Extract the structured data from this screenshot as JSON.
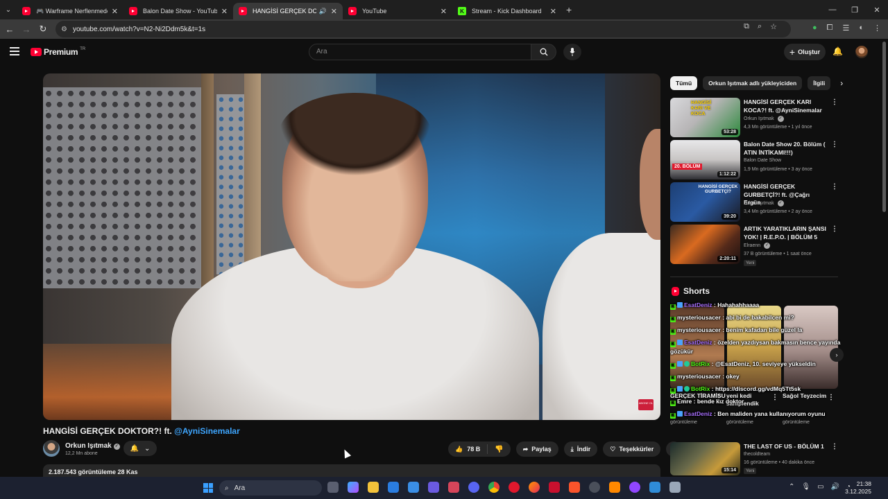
{
  "browser": {
    "tabs": [
      {
        "label": "🎮 Warframe Nerflenmeden O...",
        "active": false
      },
      {
        "label": "Balon Date Show - YouTube",
        "active": false
      },
      {
        "label": "HANGİSİ GERÇEK DOKTOR...",
        "active": true
      },
      {
        "label": "YouTube",
        "active": false
      },
      {
        "label": "Stream - Kick Dashboard",
        "active": false
      }
    ],
    "url": "youtube.com/watch?v=N2-Ni2Ddm5k&t=1s"
  },
  "masthead": {
    "logo_text": "Premium",
    "logo_sup": "TR",
    "search_placeholder": "Ara",
    "create_label": "Oluştur"
  },
  "video": {
    "title_main": "HANGİSİ GERÇEK DOKTOR?! ft. ",
    "title_mention": "@AyniSinemalar",
    "watermark": "ABONE OL",
    "channel": "Orkun Işıtmak",
    "subscribers": "12,2 Mn abone",
    "likes": "78 B",
    "share": "Paylaş",
    "download": "İndir",
    "thanks": "Teşekkürler",
    "description": "2.187.543 görüntüleme  28 Kas"
  },
  "chips": [
    "Tümü",
    "Orkun Işıtmak adlı yükleyiciden",
    "İlgili"
  ],
  "recommendations": [
    {
      "title": "HANGİSİ GERÇEK KARI KOCA?! ft. @AyniSinemalar",
      "channel": "Orkun Işıtmak",
      "verified": true,
      "meta": "4,3 Mn görüntüleme • 1 yıl önce",
      "duration": "53:28",
      "thumb_text": "HANGİSİ KARI VE KOCA"
    },
    {
      "title": "Balon Date Show 20. Bölüm ( ATIN İNTİKAMI!!!)",
      "channel": "Balon Date Show",
      "verified": false,
      "meta": "1,9 Mn görüntüleme • 3 ay önce",
      "duration": "1:12:22",
      "thumb_text": "20. BÖLÜM"
    },
    {
      "title": "HANGİSİ GERÇEK GURBETÇİ?! ft. @Çağrı Ergün",
      "channel": "Orkun Işıtmak",
      "verified": true,
      "meta": "3,4 Mn görüntüleme • 2 ay önce",
      "duration": "39:20",
      "thumb_text": "HANGİSİ GERÇEK GURBETÇİ?"
    },
    {
      "title": "ARTIK YARATIKLARIN ŞANSI YOK! | R.E.P.O. | BÖLÜM 5",
      "channel": "Elraenn",
      "verified": true,
      "meta": "37 B görüntüleme • 1 saat önce",
      "duration": "2:20:11",
      "badge": "Yeni"
    }
  ],
  "shorts": {
    "heading": "Shorts",
    "items": [
      {
        "title": "GERÇEK TİRAMİSU ...",
        "views": "görüntüleme"
      },
      {
        "title": "yeni kedi sahiplendik",
        "views": "görüntüleme"
      },
      {
        "title": "Sağol Teyzecim",
        "views": "görüntüleme"
      }
    ]
  },
  "chat": [
    {
      "user": "EsatDeniz",
      "color": "#a970ff",
      "text": "Hahahahhaaaa"
    },
    {
      "user": "mysteriousacer",
      "color": "#ffffff",
      "text": "abi bi de bakabilcen mi?"
    },
    {
      "user": "mysteriousacer",
      "color": "#ffffff",
      "text": "benim kafadan bile güzel la"
    },
    {
      "user": "EsatDeniz",
      "color": "#a970ff",
      "text": "özelden yazdıysan bakmasın bence yayında gözükür"
    },
    {
      "user": "BotRix",
      "color": "#53fc18",
      "text": "@EsatDeniz, 10. seviyeye yükseldin"
    },
    {
      "user": "mysteriousacer",
      "color": "#ffffff",
      "text": "okey"
    },
    {
      "user": "BotRix",
      "color": "#53fc18",
      "text": "https://discord.gg/vdMq5Tt5sk"
    },
    {
      "user": "Emre",
      "color": "#ffffff",
      "text": "bende kız doktor"
    },
    {
      "user": "EsatDeniz",
      "color": "#a970ff",
      "text": "Ben maliden yana kullanıyorum oyunu"
    }
  ],
  "rec_after": {
    "title": "THE LAST OF US - BÖLÜM 1",
    "channel": "thecoldteam",
    "meta": "16 görüntüleme • 40 dakika önce",
    "duration": "15:14",
    "badge": "Yeni"
  },
  "taskbar": {
    "search": "Ara",
    "time": "21:38",
    "date": "3.12.2025"
  },
  "colors": {
    "accent": "#ff0033",
    "link": "#3ea6ff",
    "kick": "#53fc18"
  }
}
